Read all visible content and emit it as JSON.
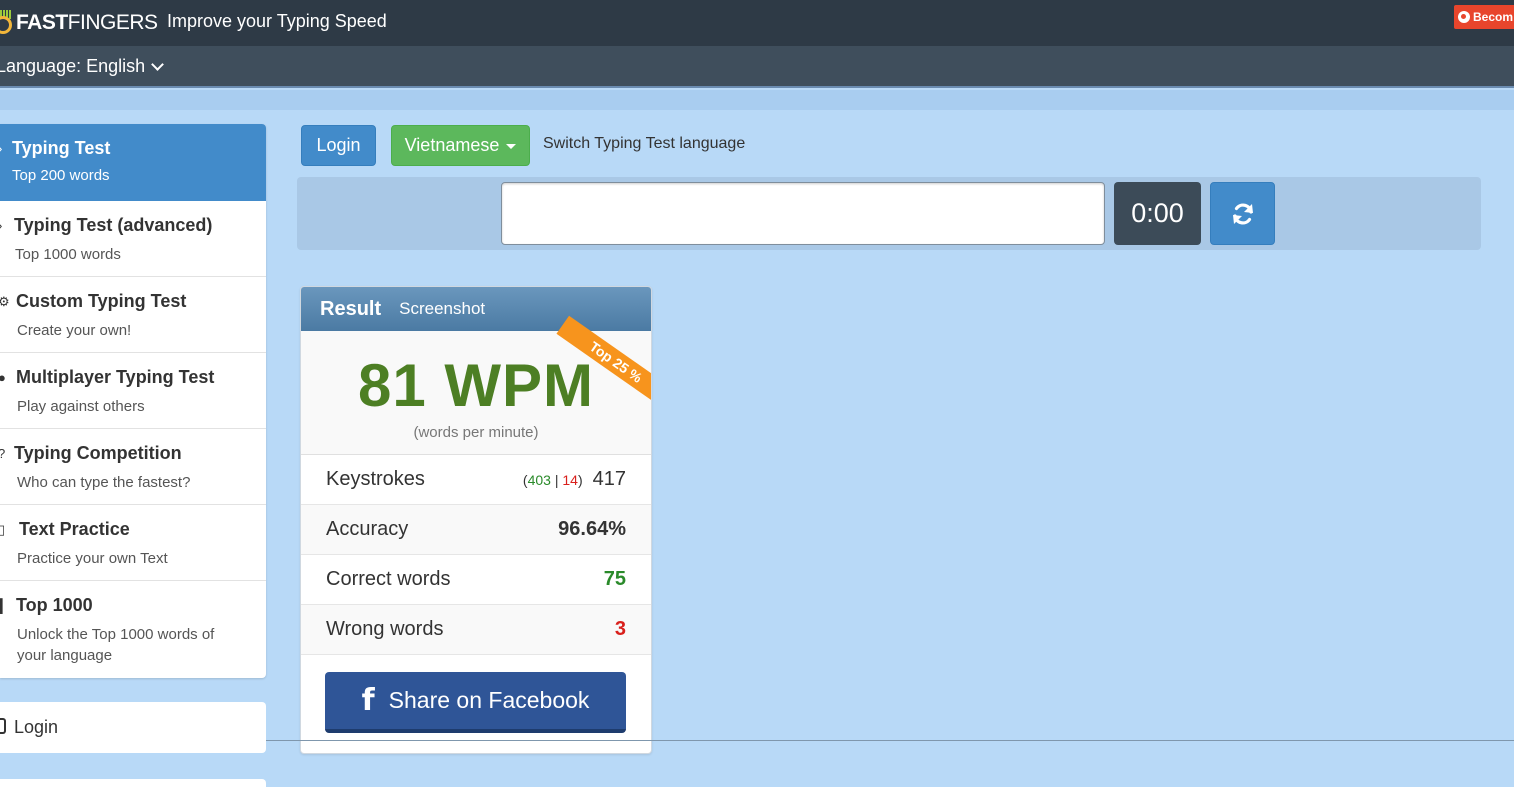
{
  "header": {
    "logo_bold": "FAST",
    "logo_light": "FINGERS",
    "tagline": "Improve your Typing Speed",
    "patreon_label": "Becom"
  },
  "language_bar": {
    "label": "Language: English"
  },
  "sidebar": {
    "items": [
      {
        "title": "Typing Test",
        "subtitle": "Top 200 words",
        "active": true,
        "icon": "chevron-icon"
      },
      {
        "title": "Typing Test (advanced)",
        "subtitle": "Top 1000 words",
        "active": false,
        "icon": "chevron-icon"
      },
      {
        "title": "Custom Typing Test",
        "subtitle": "Create your own!",
        "active": false,
        "icon": "cogs-icon"
      },
      {
        "title": "Multiplayer Typing Test",
        "subtitle": "Play against others",
        "active": false,
        "icon": "users-icon"
      },
      {
        "title": "Typing Competition",
        "subtitle": "Who can type the fastest?",
        "active": false,
        "icon": "trophy-icon"
      },
      {
        "title": "Text Practice",
        "subtitle": "Practice your own Text",
        "active": false,
        "icon": "document-icon"
      },
      {
        "title": "Top 1000",
        "subtitle": "Unlock the Top 1000 words of your language",
        "active": false,
        "icon": "bar-chart-icon"
      }
    ],
    "login_label": "Login"
  },
  "toolbar": {
    "login_label": "Login",
    "language_label": "Vietnamese",
    "switch_text": "Switch Typing Test language"
  },
  "typing": {
    "input_value": "",
    "timer": "0:00"
  },
  "result": {
    "title": "Result",
    "screenshot_label": "Screenshot",
    "ribbon": "Top 25 %",
    "wpm": "81 WPM",
    "wpm_sub": "(words per minute)",
    "keystrokes_label": "Keystrokes",
    "keystrokes_correct": "403",
    "keystrokes_wrong": "14",
    "keystrokes_total": "417",
    "accuracy_label": "Accuracy",
    "accuracy_value": "96.64%",
    "correct_label": "Correct words",
    "correct_value": "75",
    "wrong_label": "Wrong words",
    "wrong_value": "3",
    "share_label": "Share on Facebook"
  },
  "colors": {
    "topbar": "#2e3a46",
    "primary": "#428bca",
    "success": "#5cb85c",
    "wpm_green": "#4d7f24",
    "facebook": "#2f5597",
    "ribbon": "#f7941d"
  }
}
